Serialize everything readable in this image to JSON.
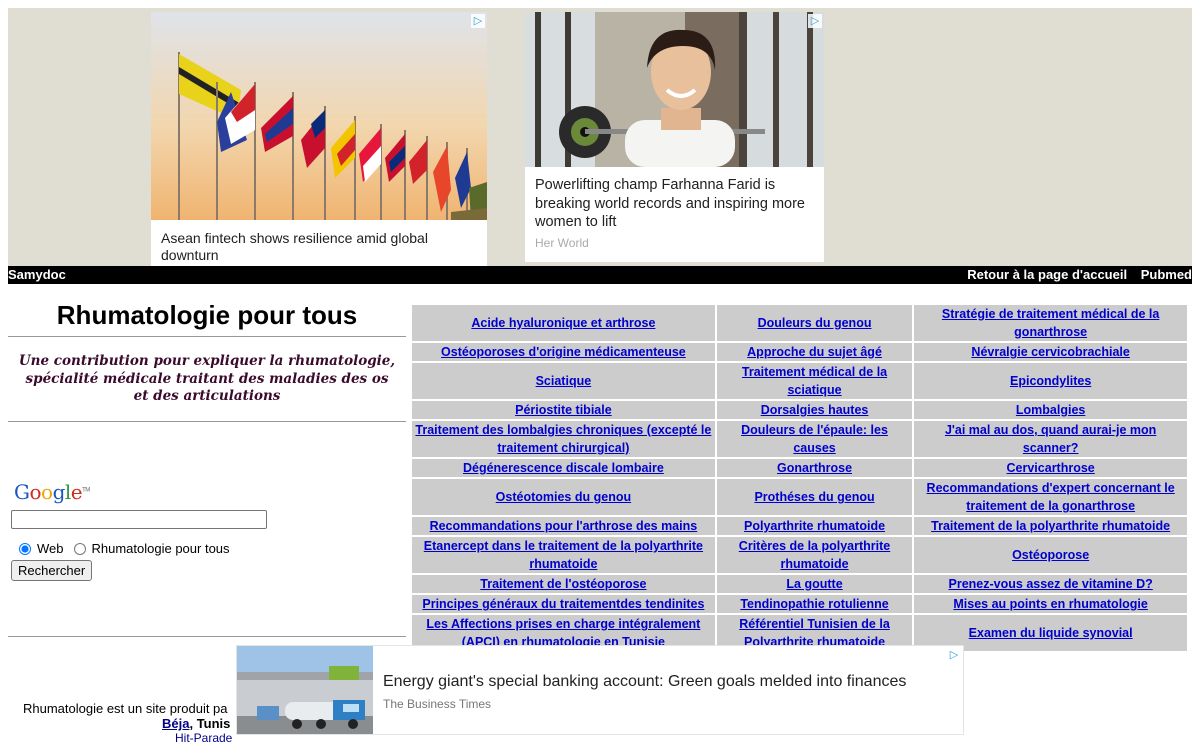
{
  "ads_top": [
    {
      "caption": "Asean fintech shows resilience amid global downturn"
    },
    {
      "caption": "Powerlifting champ Farhanna Farid is breaking world records and inspiring more women to lift",
      "source": "Her World"
    }
  ],
  "adchoices_glyph": "▷",
  "topbar": {
    "brand": "Samydoc",
    "home_link": "Retour à la page d'accueil",
    "pubmed_link": "Pubmed"
  },
  "site": {
    "title": "Rhumatologie pour tous",
    "tagline": "Une contribution pour expliquer la rhumatologie, spécialité médicale traitant des maladies des os et des articulations"
  },
  "search": {
    "logo": "Google",
    "logo_tm": "TM",
    "value": "",
    "radio_web": "Web",
    "radio_site": "Rhumatologie pour tous",
    "button": "Rechercher"
  },
  "links": [
    [
      "Acide hyaluronique et arthrose",
      "Douleurs du genou",
      "Stratégie de traitement médical de la gonarthrose"
    ],
    [
      "Ostéoporoses d'origine médicamenteuse",
      "Approche du sujet âgé",
      "Névralgie cervicobrachiale"
    ],
    [
      "Sciatique",
      "Traitement médical de la sciatique",
      "Epicondylites"
    ],
    [
      "Périostite tibiale",
      "Dorsalgies hautes",
      "Lombalgies"
    ],
    [
      "Traitement des lombalgies chroniques (excepté le traitement chirurgical)",
      "Douleurs de l'épaule: les causes",
      "J'ai mal au dos, quand aurai-je mon scanner?"
    ],
    [
      "Dégénerescence discale lombaire",
      "Gonarthrose",
      "Cervicarthrose"
    ],
    [
      "Ostéotomies du genou",
      "Prothéses du genou",
      "Recommandations d'expert concernant le traitement de la gonarthrose"
    ],
    [
      "Recommandations pour l'arthrose des mains",
      "Polyarthrite rhumatoide",
      "Traitement de la polyarthrite rhumatoide"
    ],
    [
      "Etanercept dans le traitement de la polyarthrite rhumatoide",
      "Critères de la polyarthrite rhumatoide",
      "Ostéoporose"
    ],
    [
      "Traitement de l'ostéoporose",
      "La goutte",
      "Prenez-vous assez de vitamine D?"
    ],
    [
      "Principes généraux du traitementdes tendinites",
      "Tendinopathie rotulienne",
      "Mises au points en rhumatologie"
    ],
    [
      "Les Affections prises en charge intégralement (APCI) en rhumatologie en Tunisie",
      "Référentiel Tunisien de la Polyarthrite rhumatoide",
      "Examen du liquide synovial"
    ]
  ],
  "footer": {
    "line1": "Rhumatologie est un site produit pa",
    "line2_link1": "Béja",
    "line2_sep": ", ",
    "line2_link2": "Tunis",
    "line3": "Hit-Parade"
  },
  "ad_bottom": {
    "headline": "Energy giant's special banking account: Green goals melded into finances",
    "source": "The Business Times"
  }
}
